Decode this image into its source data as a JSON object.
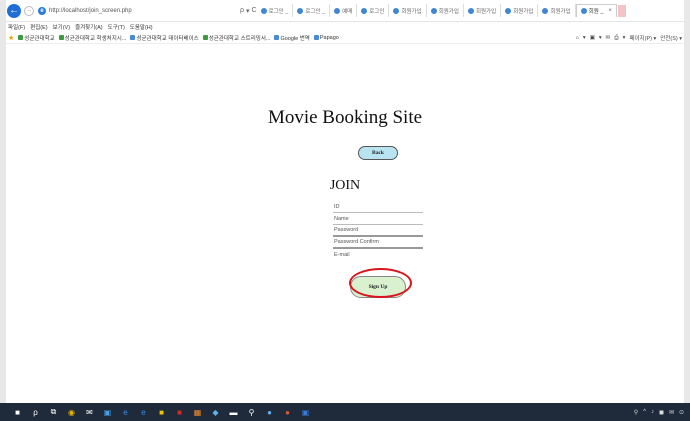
{
  "browser": {
    "back_symbol": "←",
    "forward_symbol": "→",
    "ie_symbol": "e",
    "url": "http://localhost/join_screen.php",
    "url_controls": [
      "ρ",
      "▾",
      "C"
    ],
    "tabs": [
      {
        "label": "로그인 _"
      },
      {
        "label": "로그인 _"
      },
      {
        "label": "예매"
      },
      {
        "label": "로그인"
      },
      {
        "label": "회원가입"
      },
      {
        "label": "회원가입"
      },
      {
        "label": "회원가입"
      },
      {
        "label": "회원가입"
      },
      {
        "label": "회원가입"
      },
      {
        "label": "회원 _",
        "active": true,
        "close": "×"
      }
    ],
    "menu": [
      "파일(F)",
      "편집(E)",
      "보기(V)",
      "즐겨찾기(A)",
      "도구(T)",
      "도움말(H)"
    ],
    "favorites": [
      {
        "label": "성균관대학교"
      },
      {
        "label": "성균관대학교 학생처지시..."
      },
      {
        "label": "성균관대학교 데이터베이스"
      },
      {
        "label": "성균관대학교 스트리밍서..."
      },
      {
        "label": "Google 번역"
      },
      {
        "label": "Papago"
      }
    ],
    "fav_tools": [
      "▾",
      "▾",
      "▾",
      "페이지(P) ▾",
      "안전(S) ▾"
    ]
  },
  "page": {
    "site_title": "Movie Booking Site",
    "back_button": "Back",
    "join_title": "JOIN",
    "fields": [
      {
        "placeholder": "ID"
      },
      {
        "placeholder": "Name"
      },
      {
        "placeholder": "Password"
      },
      {
        "placeholder": "Password Confirm"
      },
      {
        "placeholder": "E-mail"
      }
    ],
    "signup_button": "Sign Up"
  },
  "taskbar": {
    "icons": [
      "■",
      "ρ",
      "⧉",
      "◉",
      "✉",
      "▣",
      "e",
      "e",
      "■",
      "■",
      "▦",
      "◆",
      "▬",
      "⚲",
      "●",
      "●",
      "▣"
    ],
    "tray": [
      "⚲",
      "^",
      "♪",
      "◼",
      "✉",
      "⊙"
    ]
  },
  "colors": {
    "back_button_bg": "#b8e4f2",
    "signup_button_bg": "#d9f1cf",
    "highlight_ring": "#d9151b",
    "taskbar_bg": "#1f2b3a"
  }
}
